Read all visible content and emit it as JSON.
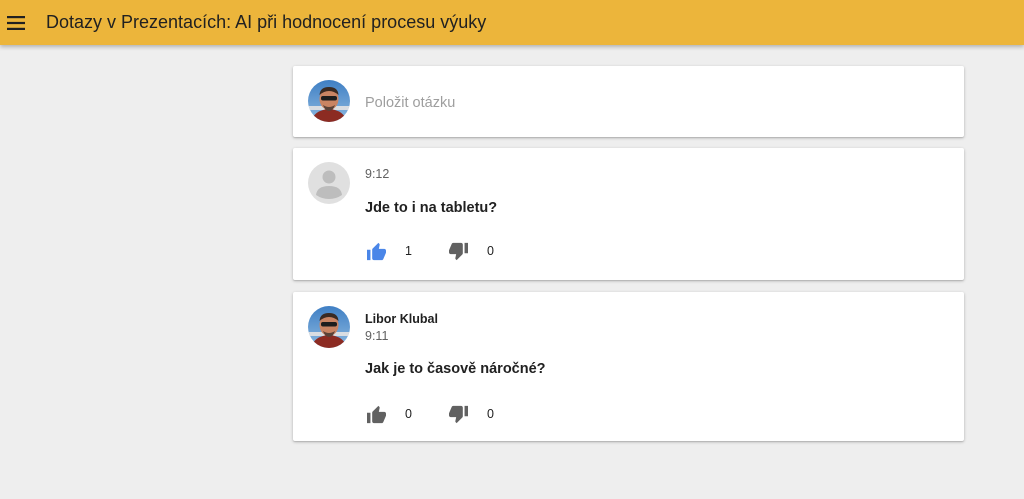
{
  "header": {
    "title": "Dotazy v Prezentacích: AI při hodnocení procesu výuky",
    "menu_icon": "hamburger-menu-icon",
    "background": "#ecb53b"
  },
  "ask": {
    "placeholder": "Položit otázku"
  },
  "questions": [
    {
      "author": "",
      "time": "9:12",
      "text": "Jde to i na tabletu?",
      "likes": "1",
      "dislikes": "0",
      "liked": true
    },
    {
      "author": "Libor Klubal",
      "time": "9:11",
      "text": "Jak je to časově náročné?",
      "likes": "0",
      "dislikes": "0",
      "liked": false
    }
  ],
  "colors": {
    "accent": "#ecb53b",
    "like_active": "#4a86e8",
    "icon_inactive": "#616161",
    "page_background": "#eeeeee"
  }
}
